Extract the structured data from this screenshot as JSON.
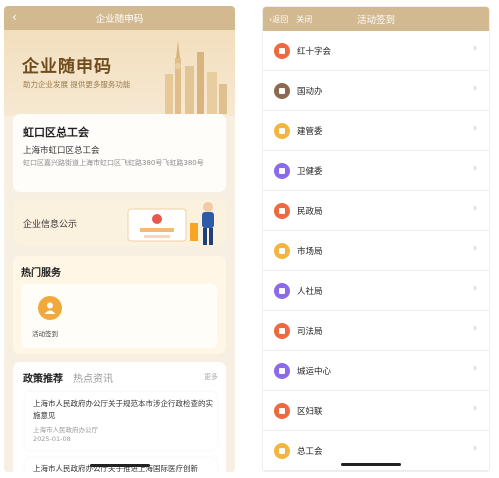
{
  "left": {
    "nav_title": "企业随申码",
    "back_glyph": "‹",
    "hero": {
      "title": "企业随申码",
      "subtitle": "助力企业发展  提供更多服务功能"
    },
    "org": {
      "name": "虹口区总工会",
      "full_name": "上海市虹口区总工会",
      "address": "虹口区嘉兴路街道上海市虹口区飞虹路380号飞虹路380号"
    },
    "info": {
      "label": "企业信息公示"
    },
    "hot": {
      "title": "热门服务",
      "item_label": "活动签到",
      "icon_color": "#f2a93b"
    },
    "policy": {
      "tab_active": "政策推荐",
      "tab_other": "热点资讯",
      "more": "更多",
      "items": [
        {
          "title": "上海市人民政府办公厅关于规范本市涉企行政检查的实施意见",
          "source": "上海市人民政府办公厅",
          "date": "2025-01-08"
        },
        {
          "title": "上海市人民政府办公厅关于推进上海国际医疗创新"
        }
      ]
    }
  },
  "right": {
    "nav_title": "活动签到",
    "back_label": "返回",
    "close_label": "关闭",
    "back_glyph": "‹",
    "arrow_glyph": "›",
    "items": [
      {
        "label": "红十字会",
        "color": "#f06a3f"
      },
      {
        "label": "国动办",
        "color": "#8d6a4f"
      },
      {
        "label": "建管委",
        "color": "#f4b53f"
      },
      {
        "label": "卫健委",
        "color": "#8c6bea"
      },
      {
        "label": "民政局",
        "color": "#f06a3f"
      },
      {
        "label": "市场局",
        "color": "#f4b53f"
      },
      {
        "label": "人社局",
        "color": "#8c6bea"
      },
      {
        "label": "司法局",
        "color": "#f06a3f"
      },
      {
        "label": "城运中心",
        "color": "#8c6bea"
      },
      {
        "label": "区妇联",
        "color": "#f06a3f"
      },
      {
        "label": "总工会",
        "color": "#f4b53f"
      }
    ]
  },
  "colors": {
    "nav": "#d2b98f",
    "brand_text": "#6f4b1e"
  }
}
